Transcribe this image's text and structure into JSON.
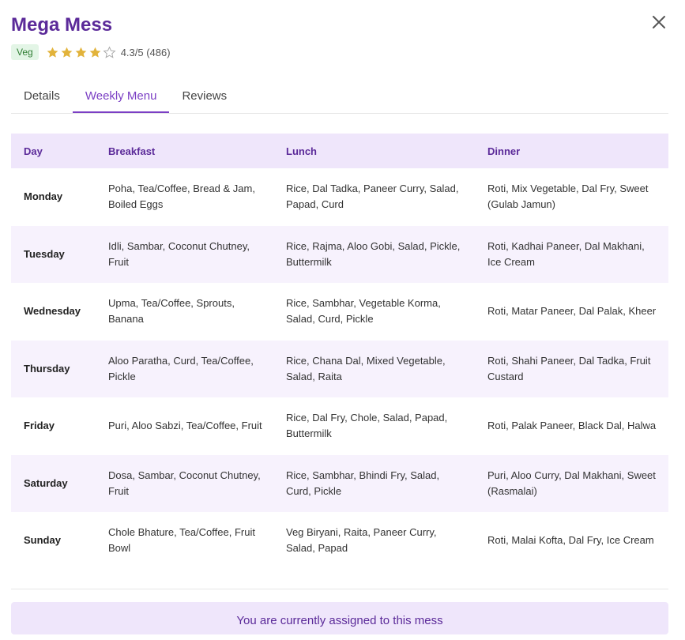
{
  "header": {
    "title": "Mega Mess",
    "badge": "Veg",
    "rating_text": "4.3/5 (486)",
    "stars": [
      "full",
      "full",
      "full",
      "full",
      "empty"
    ],
    "star_color": "#e2b33b",
    "close_icon": "close-icon"
  },
  "tabs": [
    {
      "label": "Details",
      "active": false
    },
    {
      "label": "Weekly Menu",
      "active": true
    },
    {
      "label": "Reviews",
      "active": false
    }
  ],
  "menu": {
    "headers": [
      "Day",
      "Breakfast",
      "Lunch",
      "Dinner"
    ],
    "rows": [
      {
        "day": "Monday",
        "breakfast": "Poha, Tea/Coffee, Bread & Jam, Boiled Eggs",
        "lunch": "Rice, Dal Tadka, Paneer Curry, Salad, Papad, Curd",
        "dinner": "Roti, Mix Vegetable, Dal Fry, Sweet (Gulab Jamun)"
      },
      {
        "day": "Tuesday",
        "breakfast": "Idli, Sambar, Coconut Chutney, Fruit",
        "lunch": "Rice, Rajma, Aloo Gobi, Salad, Pickle, Buttermilk",
        "dinner": "Roti, Kadhai Paneer, Dal Makhani, Ice Cream"
      },
      {
        "day": "Wednesday",
        "breakfast": "Upma, Tea/Coffee, Sprouts, Banana",
        "lunch": "Rice, Sambhar, Vegetable Korma, Salad, Curd, Pickle",
        "dinner": "Roti, Matar Paneer, Dal Palak, Kheer"
      },
      {
        "day": "Thursday",
        "breakfast": "Aloo Paratha, Curd, Tea/Coffee, Pickle",
        "lunch": "Rice, Chana Dal, Mixed Vegetable, Salad, Raita",
        "dinner": "Roti, Shahi Paneer, Dal Tadka, Fruit Custard"
      },
      {
        "day": "Friday",
        "breakfast": "Puri, Aloo Sabzi, Tea/Coffee, Fruit",
        "lunch": "Rice, Dal Fry, Chole, Salad, Papad, Buttermilk",
        "dinner": "Roti, Palak Paneer, Black Dal, Halwa"
      },
      {
        "day": "Saturday",
        "breakfast": "Dosa, Sambar, Coconut Chutney, Fruit",
        "lunch": "Rice, Sambhar, Bhindi Fry, Salad, Curd, Pickle",
        "dinner": "Puri, Aloo Curry, Dal Makhani, Sweet (Rasmalai)"
      },
      {
        "day": "Sunday",
        "breakfast": "Chole Bhature, Tea/Coffee, Fruit Bowl",
        "lunch": "Veg Biryani, Raita, Paneer Curry, Salad, Papad",
        "dinner": "Roti, Malai Kofta, Dal Fry, Ice Cream"
      }
    ]
  },
  "status": {
    "assigned_text": "You are currently assigned to this mess"
  },
  "colors": {
    "brand": "#5b2a99",
    "accent": "#7b3fc4",
    "header_bg": "#efe6fb",
    "alt_row_bg": "#f7f2fd",
    "veg_badge_bg": "#e3f5e6"
  }
}
